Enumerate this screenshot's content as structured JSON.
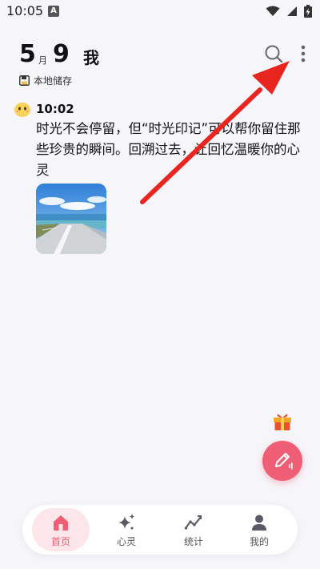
{
  "status_bar": {
    "time": "10:05",
    "notification_letter": "A",
    "icons": [
      "wifi-icon",
      "cellular-icon",
      "battery-charging-icon"
    ]
  },
  "header": {
    "month_number": "5",
    "month_unit": "月",
    "day_number": "9",
    "title": "我",
    "storage_label": "本地储存",
    "icons": [
      "search-icon",
      "more-vertical-icon"
    ]
  },
  "entry": {
    "time": "10:02",
    "text": "时光不会停留，但“时光印记”可以帮你留住那些珍贵的瞬间。回溯过去，让回忆温暖你的心灵",
    "photo_icon": "seaside-road-photo"
  },
  "floating": {
    "gift_icon": "gift-icon",
    "compose_icon": "pen-voice-icon",
    "accent_color": "#ef5e74"
  },
  "nav": {
    "items": [
      {
        "label": "首页",
        "icon": "home-icon",
        "active": true
      },
      {
        "label": "心灵",
        "icon": "sparkle-icon",
        "active": false
      },
      {
        "label": "统计",
        "icon": "trend-line-icon",
        "active": false
      },
      {
        "label": "我的",
        "icon": "person-icon",
        "active": false
      }
    ]
  },
  "overlay": {
    "annotation_color": "#e8251f",
    "annotation_icon": "red-arrow-annotation"
  }
}
